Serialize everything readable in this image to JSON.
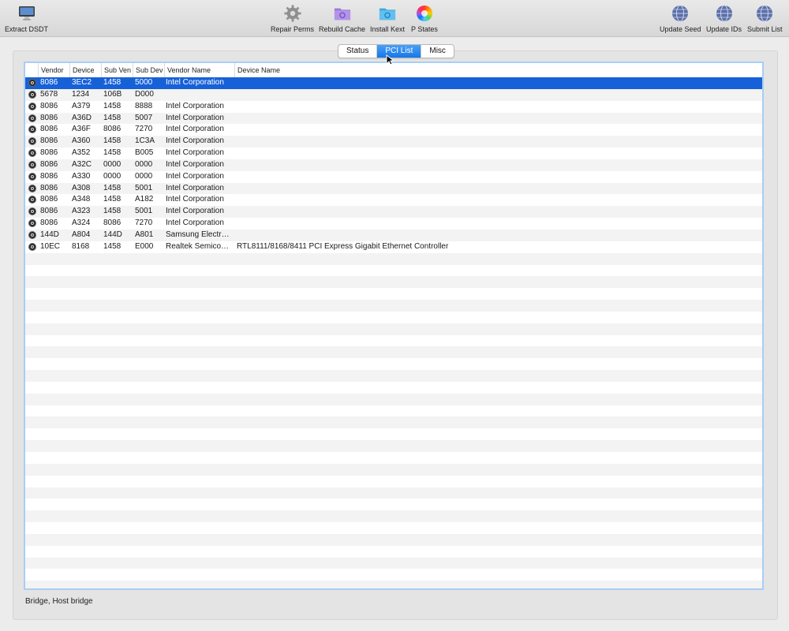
{
  "toolbar": {
    "left": [
      {
        "label": "Extract DSDT",
        "icon": "imac-icon"
      }
    ],
    "center": [
      {
        "label": "Repair Perms",
        "icon": "gear-icon"
      },
      {
        "label": "Rebuild Cache",
        "icon": "folder-gear-icon"
      },
      {
        "label": "Install Kext",
        "icon": "folder-install-icon"
      },
      {
        "label": "P States",
        "icon": "color-wheel-icon"
      }
    ],
    "right": [
      {
        "label": "Update Seed",
        "icon": "globe-icon"
      },
      {
        "label": "Update IDs",
        "icon": "globe-icon"
      },
      {
        "label": "Submit List",
        "icon": "globe-icon"
      }
    ]
  },
  "tabs": [
    {
      "label": "Status",
      "active": false
    },
    {
      "label": "PCI List",
      "active": true
    },
    {
      "label": "Misc",
      "active": false
    }
  ],
  "table": {
    "columns": [
      "Vendor",
      "Device",
      "Sub Ven",
      "Sub Dev",
      "Vendor Name",
      "Device Name"
    ],
    "selected_index": 0,
    "rows": [
      [
        "8086",
        "3EC2",
        "1458",
        "5000",
        "Intel Corporation",
        ""
      ],
      [
        "5678",
        "1234",
        "106B",
        "D000",
        "",
        ""
      ],
      [
        "8086",
        "A379",
        "1458",
        "8888",
        "Intel Corporation",
        ""
      ],
      [
        "8086",
        "A36D",
        "1458",
        "5007",
        "Intel Corporation",
        ""
      ],
      [
        "8086",
        "A36F",
        "8086",
        "7270",
        "Intel Corporation",
        ""
      ],
      [
        "8086",
        "A360",
        "1458",
        "1C3A",
        "Intel Corporation",
        ""
      ],
      [
        "8086",
        "A352",
        "1458",
        "B005",
        "Intel Corporation",
        ""
      ],
      [
        "8086",
        "A32C",
        "0000",
        "0000",
        "Intel Corporation",
        ""
      ],
      [
        "8086",
        "A330",
        "0000",
        "0000",
        "Intel Corporation",
        ""
      ],
      [
        "8086",
        "A308",
        "1458",
        "5001",
        "Intel Corporation",
        ""
      ],
      [
        "8086",
        "A348",
        "1458",
        "A182",
        "Intel Corporation",
        ""
      ],
      [
        "8086",
        "A323",
        "1458",
        "5001",
        "Intel Corporation",
        ""
      ],
      [
        "8086",
        "A324",
        "8086",
        "7270",
        "Intel Corporation",
        ""
      ],
      [
        "144D",
        "A804",
        "144D",
        "A801",
        "Samsung Electr…",
        ""
      ],
      [
        "10EC",
        "8168",
        "1458",
        "E000",
        "Realtek Semico…",
        "RTL8111/8168/8411 PCI Express Gigabit Ethernet Controller"
      ]
    ]
  },
  "status": {
    "text": "Bridge, Host bridge"
  },
  "colors": {
    "selection": "#1761d8",
    "accent": "#1677e6",
    "focus_ring": "#a9cdf6"
  }
}
